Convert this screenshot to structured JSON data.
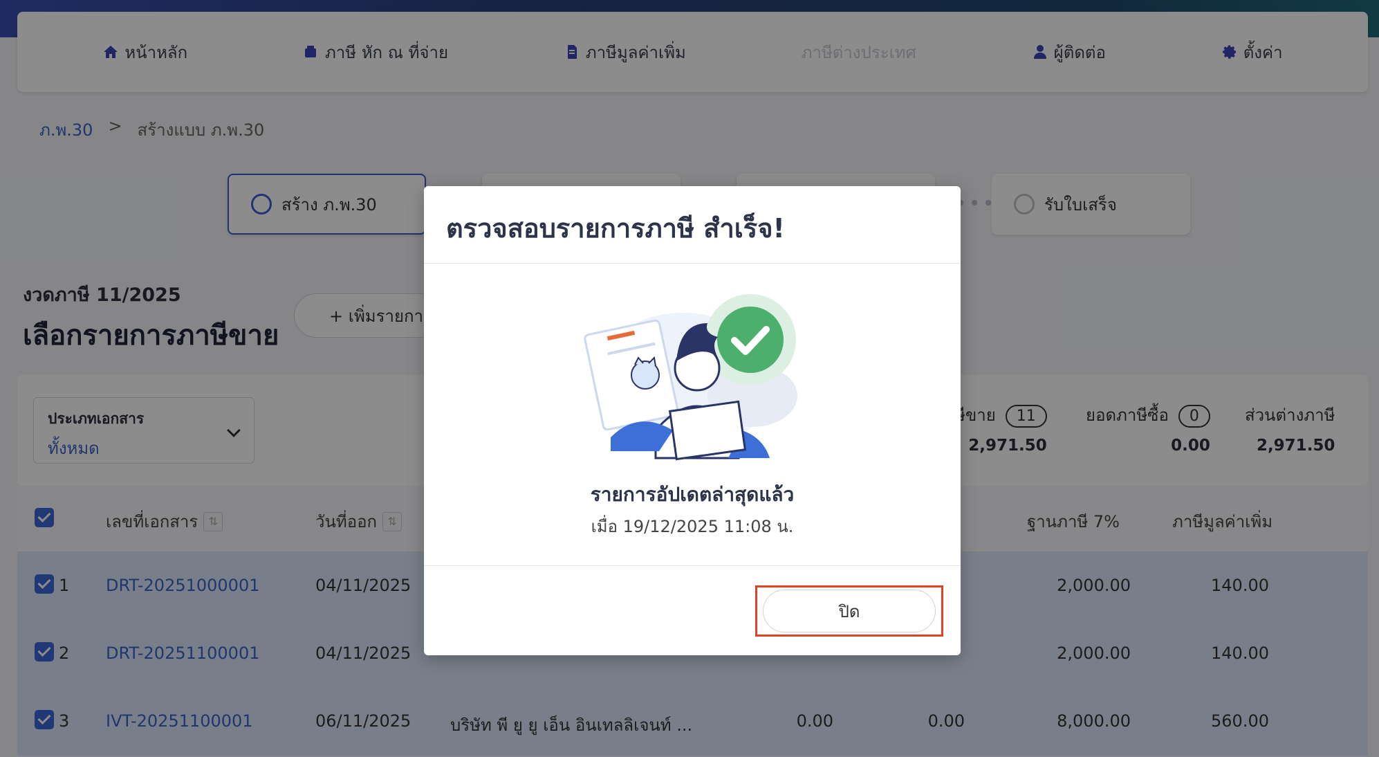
{
  "nav": {
    "items": [
      {
        "label": "หน้าหลัก",
        "icon": "home-icon"
      },
      {
        "label": "ภาษี หัก ณ ที่จ่าย",
        "icon": "wallet-icon"
      },
      {
        "label": "ภาษีมูลค่าเพิ่ม",
        "icon": "document-icon"
      },
      {
        "label": "ภาษีต่างประเทศ",
        "icon": "",
        "disabled": true
      },
      {
        "label": "ผู้ติดต่อ",
        "icon": "user-icon"
      },
      {
        "label": "ตั้งค่า",
        "icon": "gear-icon"
      }
    ]
  },
  "breadcrumb": {
    "root": "ภ.พ.30",
    "separator": ">",
    "current": "สร้างแบบ ภ.พ.30"
  },
  "steps": {
    "first": "สร้าง ภ.พ.30",
    "last": "รับใบเสร็จ"
  },
  "period": "งวดภาษี 11/2025",
  "page_title": "เลือกรายการภาษีขาย",
  "add_button": "+ เพิ่มรายกา",
  "filter": {
    "label": "ประเภทเอกสาร",
    "value": "ทั้งหมด"
  },
  "summary": {
    "sales": {
      "label": "ษีขาย",
      "count": "11",
      "amount": "2,971.50"
    },
    "purchase": {
      "label": "ยอดภาษีซื้อ",
      "count": "0",
      "amount": "0.00"
    },
    "diff": {
      "label": "ส่วนต่างภาษี",
      "amount": "2,971.50"
    }
  },
  "table": {
    "headers": {
      "doc_no": "เลขที่เอกสาร",
      "date": "วันที่ออก",
      "base": "ฐานภาษี 7%",
      "vat": "ภาษีมูลค่าเพิ่ม"
    },
    "rows": [
      {
        "idx": "1",
        "doc_no": "DRT-20251000001",
        "date": "04/11/2025",
        "customer": "",
        "c1": "",
        "c2": "",
        "base": "2,000.00",
        "vat": "140.00"
      },
      {
        "idx": "2",
        "doc_no": "DRT-20251100001",
        "date": "04/11/2025",
        "customer": "",
        "c1": "",
        "c2": "",
        "base": "2,000.00",
        "vat": "140.00"
      },
      {
        "idx": "3",
        "doc_no": "IVT-20251100001",
        "date": "06/11/2025",
        "customer": "บริษัท พี ยู ยู เอ็น อินเทลลิเจนท์ ...",
        "c1": "0.00",
        "c2": "0.00",
        "base": "8,000.00",
        "vat": "560.00"
      }
    ]
  },
  "modal": {
    "title": "ตรวจสอบรายการภาษี สำเร็จ!",
    "heading": "รายการอัปเดตล่าสุดแล้ว",
    "subtext": "เมื่อ 19/12/2025 11:08 น.",
    "close_label": "ปิด"
  },
  "colors": {
    "accent": "#3d66d8",
    "link": "#3b64c4",
    "success": "#4caf6e",
    "highlight": "#e04226"
  }
}
